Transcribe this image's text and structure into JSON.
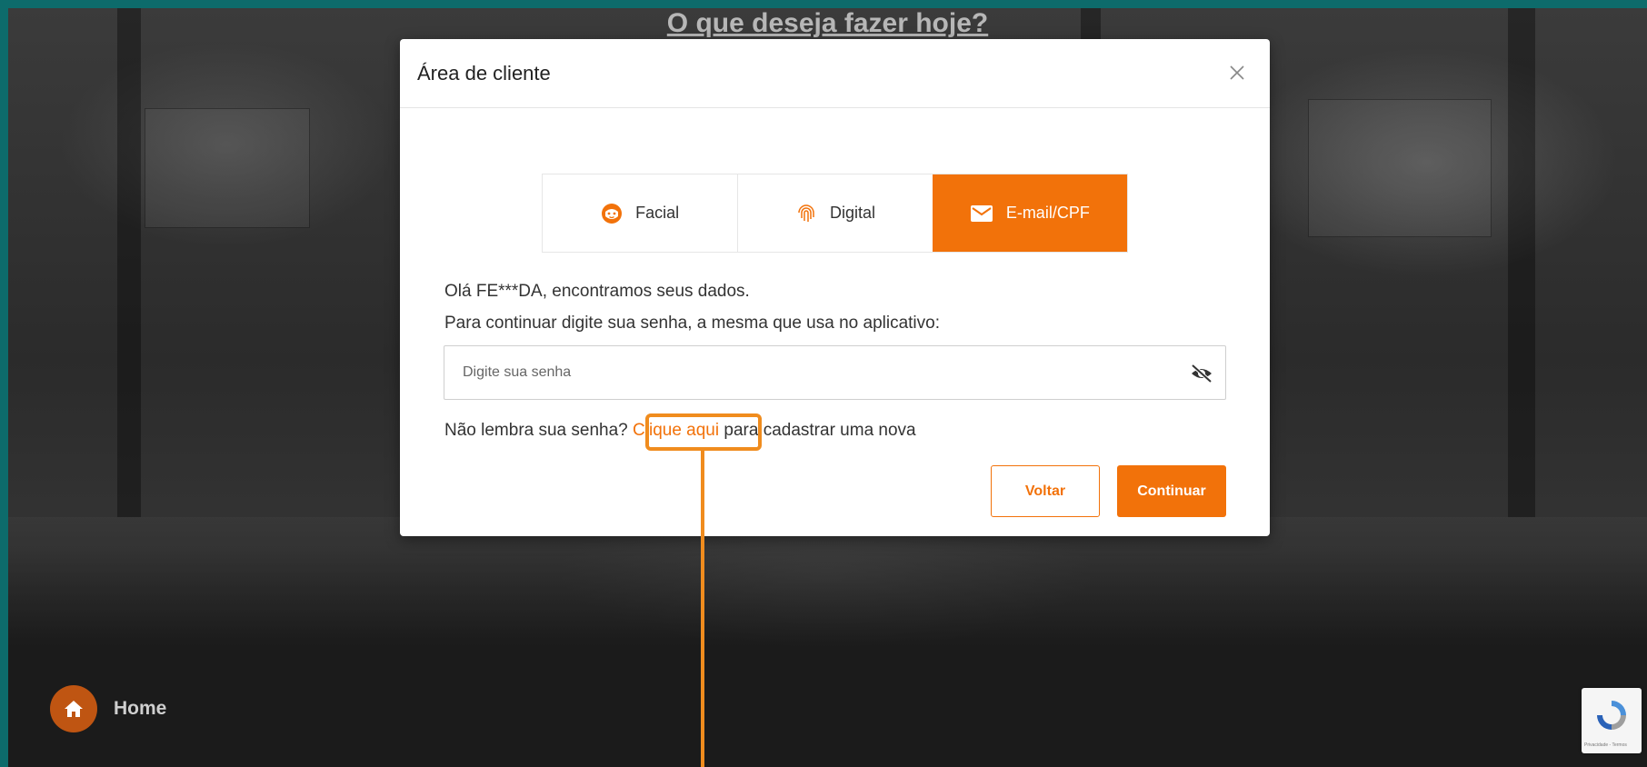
{
  "page": {
    "hero_title": "O que deseja fazer hoje?",
    "home_label": "Home",
    "recaptcha_text": "Privacidade - Termos"
  },
  "modal": {
    "title": "Área de cliente",
    "tabs": [
      {
        "label": "Facial",
        "icon": "face-icon",
        "active": false
      },
      {
        "label": "Digital",
        "icon": "fingerprint-icon",
        "active": false
      },
      {
        "label": "E-mail/CPF",
        "icon": "mail-icon",
        "active": true
      }
    ],
    "message_line1": "Olá FE***DA, encontramos seus dados.",
    "message_line2": "Para continuar digite sua senha, a mesma que usa no aplicativo:",
    "password_placeholder": "Digite sua senha",
    "forgot_prefix": "Não lembra sua senha?",
    "forgot_link": "Clique aqui",
    "forgot_suffix": "para cadastrar uma nova",
    "back_button": "Voltar",
    "continue_button": "Continuar"
  },
  "colors": {
    "accent": "#f2720a",
    "teal_border": "#0d6b6b",
    "highlight": "#f08c1e"
  }
}
